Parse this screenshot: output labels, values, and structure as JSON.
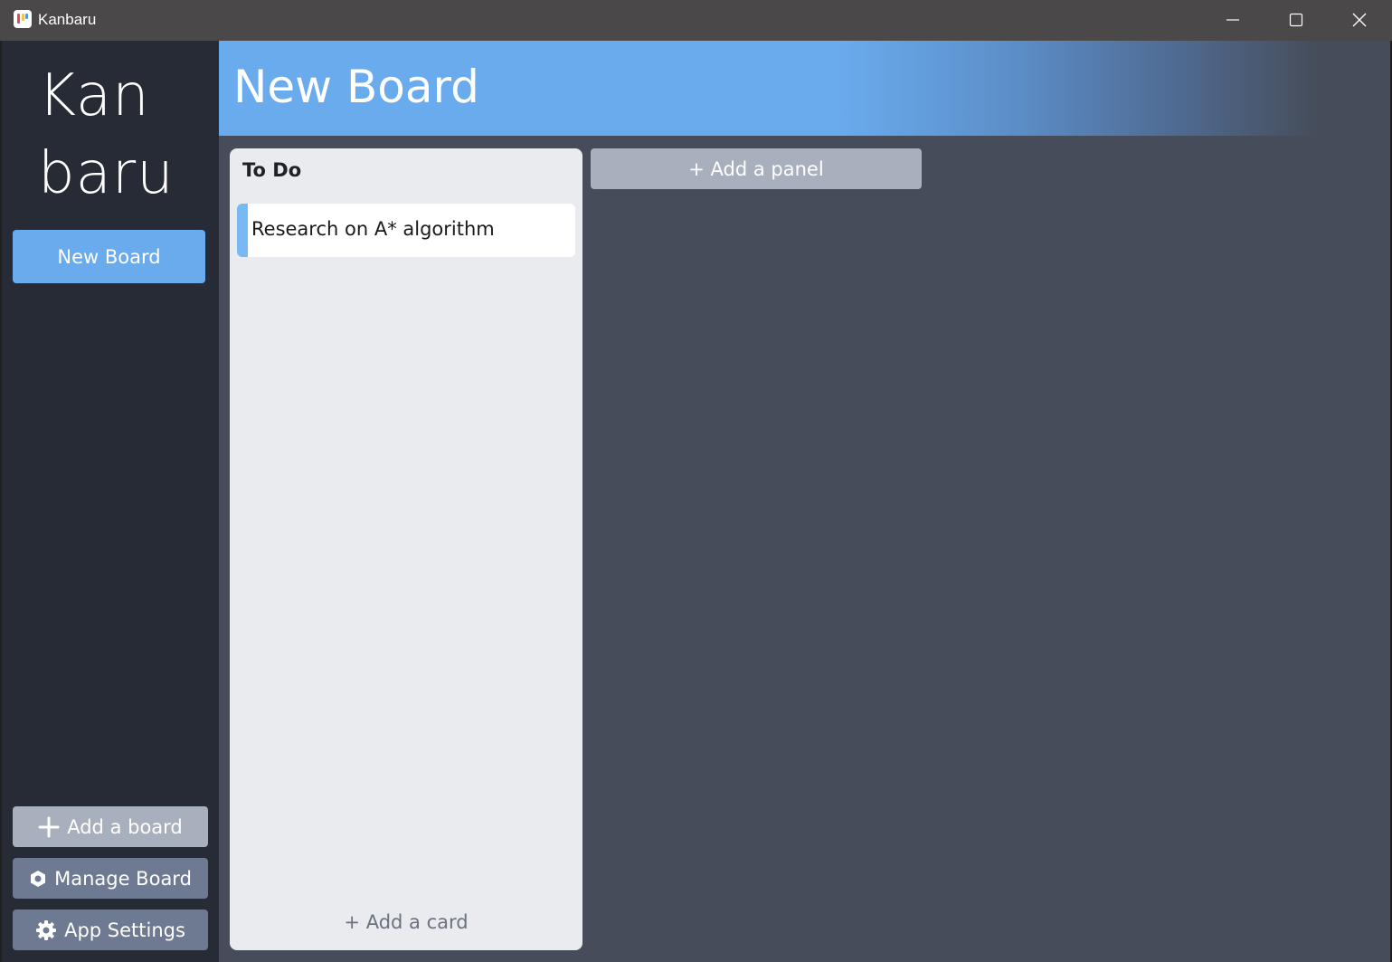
{
  "window": {
    "app_title": "Kanbaru",
    "minimize_icon": "minimize-icon",
    "maximize_icon": "maximize-icon",
    "close_icon": "close-icon"
  },
  "sidebar": {
    "logo_line1": "Kan",
    "logo_line2": "baru",
    "boards": [
      {
        "label": "New Board",
        "active": true
      }
    ],
    "add_board_label": "Add a board",
    "manage_board_label": "Manage Board",
    "app_settings_label": "App Settings"
  },
  "board": {
    "title": "New Board",
    "panels": [
      {
        "title": "To Do",
        "cards": [
          {
            "text": "Research on A* algorithm",
            "accent_color": "#78b9f4"
          }
        ],
        "add_card_label": "+ Add a card"
      }
    ],
    "add_panel_label": "+ Add a panel"
  },
  "colors": {
    "accent": "#6aabed",
    "sidebar_bg": "#272b35",
    "board_bg": "#464c59",
    "panel_bg": "#e9ebee",
    "button_gray": "#a9b0bd",
    "button_slate": "#6d7a91"
  }
}
